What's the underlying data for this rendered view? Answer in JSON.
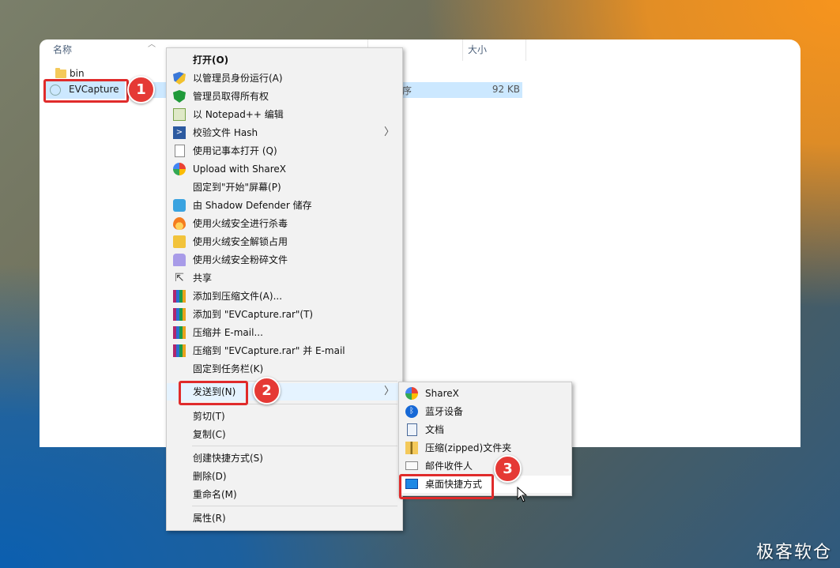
{
  "explorer": {
    "columns": {
      "name": "名称",
      "size": "大小"
    },
    "files": [
      {
        "name": "bin"
      },
      {
        "name": "EVCapture",
        "type_partial": "序",
        "size": "92 KB"
      }
    ]
  },
  "context_menu": {
    "items": [
      {
        "label": "打开(O)",
        "icon": "none",
        "bold": true
      },
      {
        "label": "以管理员身份运行(A)",
        "icon": "uac-shield-icon"
      },
      {
        "label": "管理员取得所有权",
        "icon": "green-shield-icon"
      },
      {
        "label": "以 Notepad++ 编辑",
        "icon": "notepad-plus-plus-icon"
      },
      {
        "label": "校验文件 Hash",
        "icon": "hash-icon",
        "submenu": true
      },
      {
        "label": "使用记事本打开 (Q)",
        "icon": "notepad-icon"
      },
      {
        "label": "Upload with ShareX",
        "icon": "sharex-icon"
      },
      {
        "label": "固定到\"开始\"屏幕(P)",
        "icon": "none"
      },
      {
        "label": "由 Shadow Defender 储存",
        "icon": "shadow-defender-icon"
      },
      {
        "label": "使用火绒安全进行杀毒",
        "icon": "huorong-icon"
      },
      {
        "label": "使用火绒安全解锁占用",
        "icon": "huorong-unlock-icon"
      },
      {
        "label": "使用火绒安全粉碎文件",
        "icon": "huorong-shred-icon"
      },
      {
        "label": "共享",
        "icon": "share-icon"
      },
      {
        "label": "添加到压缩文件(A)...",
        "icon": "winrar-icon"
      },
      {
        "label": "添加到 \"EVCapture.rar\"(T)",
        "icon": "winrar-icon"
      },
      {
        "label": "压缩并 E-mail...",
        "icon": "winrar-icon"
      },
      {
        "label": "压缩到 \"EVCapture.rar\" 并 E-mail",
        "icon": "winrar-icon"
      },
      {
        "label": "固定到任务栏(K)",
        "icon": "none"
      },
      {
        "label": "发送到(N)",
        "icon": "none",
        "submenu": true
      },
      {
        "label": "剪切(T)",
        "icon": "none"
      },
      {
        "label": "复制(C)",
        "icon": "none"
      },
      {
        "label": "创建快捷方式(S)",
        "icon": "none"
      },
      {
        "label": "删除(D)",
        "icon": "none"
      },
      {
        "label": "重命名(M)",
        "icon": "none"
      },
      {
        "label": "属性(R)",
        "icon": "none"
      }
    ]
  },
  "send_to_menu": {
    "items": [
      {
        "label": "ShareX",
        "icon": "sharex-icon"
      },
      {
        "label": "蓝牙设备",
        "icon": "bluetooth-icon"
      },
      {
        "label": "文档",
        "icon": "documents-icon"
      },
      {
        "label": "压缩(zipped)文件夹",
        "icon": "zip-folder-icon"
      },
      {
        "label": "邮件收件人",
        "icon": "mail-icon"
      },
      {
        "label": "桌面快捷方式",
        "icon": "desktop-icon"
      }
    ]
  },
  "annotations": {
    "step1": "1",
    "step2": "2",
    "step3": "3"
  },
  "watermark": "极客软仓",
  "colors": {
    "accent_red": "#e02b2b",
    "selection": "#cce8ff",
    "menu_bg": "#f2f2f2"
  }
}
